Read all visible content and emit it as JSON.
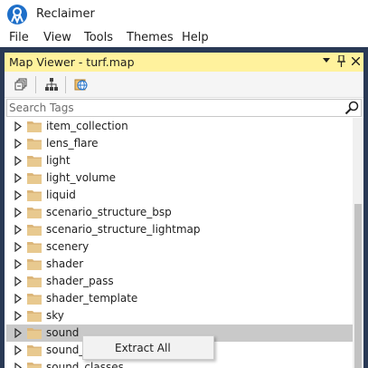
{
  "app": {
    "title": "Reclaimer",
    "logo_icon": "reclaimer-logo-icon"
  },
  "menu": [
    "File",
    "View",
    "Tools",
    "Themes",
    "Help"
  ],
  "panel": {
    "title": "Map Viewer - turf.map",
    "header_color": "#fff29d",
    "header_buttons": [
      "dropdown-icon",
      "pin-icon",
      "close-icon"
    ]
  },
  "toolbar": {
    "buttons": [
      "collapse-all-icon",
      "hierarchy-view-icon",
      "globe-view-icon"
    ]
  },
  "search": {
    "placeholder": "Search Tags",
    "value": ""
  },
  "tree": {
    "items": [
      {
        "label": "item_collection"
      },
      {
        "label": "lens_flare"
      },
      {
        "label": "light"
      },
      {
        "label": "light_volume"
      },
      {
        "label": "liquid"
      },
      {
        "label": "scenario_structure_bsp"
      },
      {
        "label": "scenario_structure_lightmap"
      },
      {
        "label": "scenery"
      },
      {
        "label": "shader"
      },
      {
        "label": "shader_pass"
      },
      {
        "label": "shader_template"
      },
      {
        "label": "sky"
      },
      {
        "label": "sound",
        "selected": true
      },
      {
        "label": "sound_"
      },
      {
        "label": "sound_classes"
      }
    ]
  },
  "context_menu": {
    "items": [
      "Extract All"
    ]
  },
  "colors": {
    "shell": "#293955",
    "selection": "#c9c9c9",
    "folder": "#dcb67a"
  }
}
